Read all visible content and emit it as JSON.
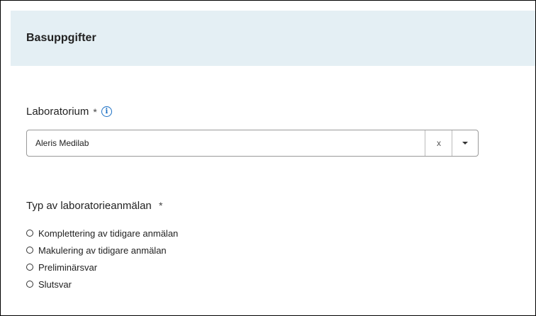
{
  "panel": {
    "title": "Basuppgifter"
  },
  "laboratorium": {
    "label": "Laboratorium",
    "required_mark": "*",
    "info_icon": "info-icon",
    "value": "Aleris Medilab",
    "clear_label": "x",
    "dropdown_icon": "caret-down-icon"
  },
  "typ": {
    "label": "Typ av laboratorieanmälan",
    "required_mark": "*",
    "options": [
      {
        "label": "Komplettering av tidigare anmälan",
        "selected": false
      },
      {
        "label": "Makulering av tidigare anmälan",
        "selected": false
      },
      {
        "label": "Preliminärsvar",
        "selected": false
      },
      {
        "label": "Slutsvar",
        "selected": false
      }
    ]
  }
}
